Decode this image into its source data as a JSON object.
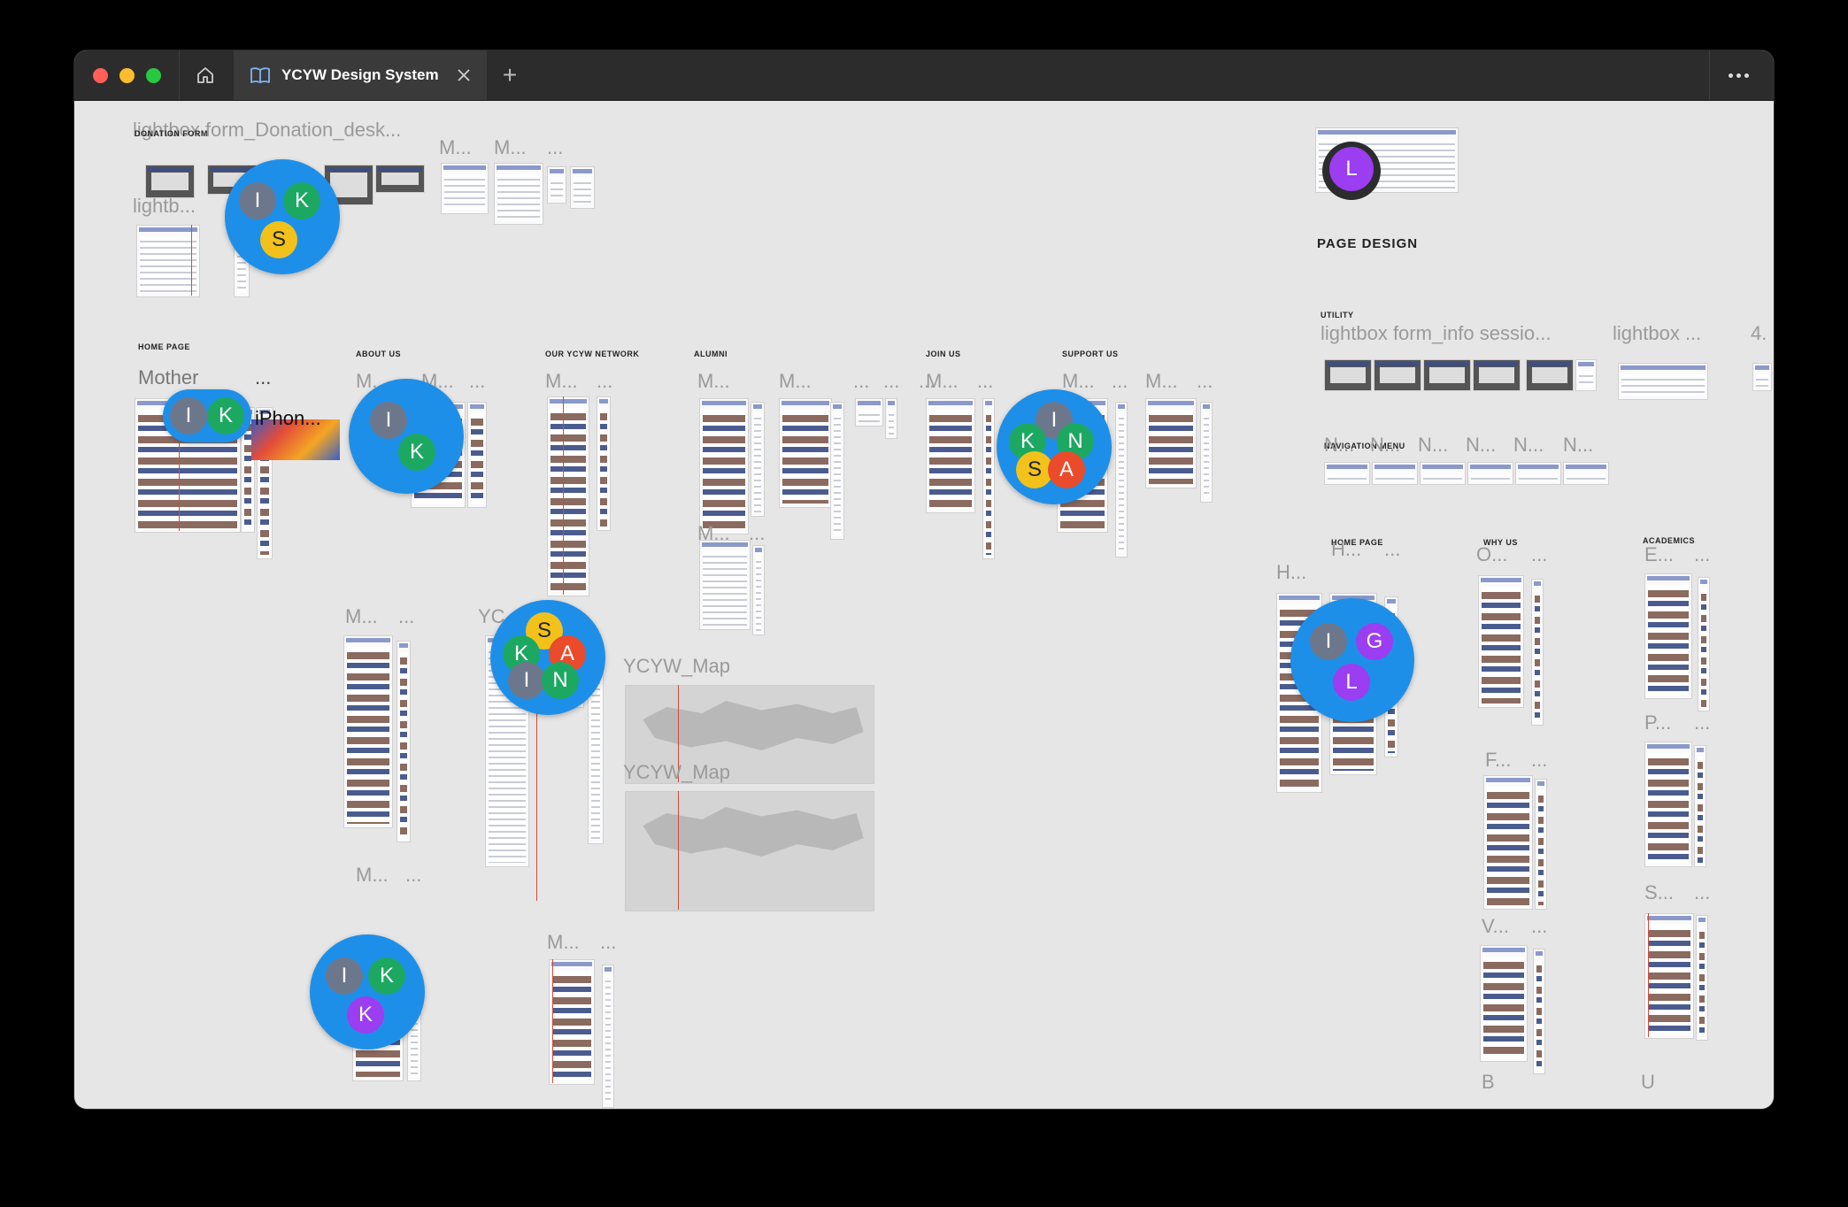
{
  "window": {
    "tab_title": "YCYW Design System",
    "new_tab_label": "+",
    "traffic_lights": {
      "close": "#ff5f57",
      "minimize": "#febc2e",
      "zoom": "#28c840"
    }
  },
  "canvas": {
    "frame_labels": {
      "lightbox_donation": "lightbox form_Donation_desk...",
      "lightb": "lightb...",
      "m1": "M...",
      "m2": "M...",
      "dots": "...",
      "mother": "Mother",
      "iphon": "iPhon...",
      "yc": "YC",
      "ycyw_map_1": "YCYW_Map",
      "ycyw_map_2": "YCYW_Map",
      "lightbox_info": "lightbox form_info sessio...",
      "lightbox_short": "lightbox ...",
      "four": "4.",
      "n": "N...",
      "h": "H...",
      "o": "O...",
      "e": "E...",
      "p": "P...",
      "f": "F...",
      "s": "S...",
      "v": "V...",
      "b": "B",
      "u": "U"
    },
    "section_titles": {
      "donation_form": "DONATION FORM",
      "home_page": "HOME PAGE",
      "about_us": "ABOUT US",
      "our_ycyw_network": "OUR YCYW NETWORK",
      "alumni": "ALUMNI",
      "join_us": "JOIN US",
      "support_us": "SUPPORT US",
      "page_design": "PAGE DESIGN",
      "utility": "UTILITY",
      "navigation_menu": "NAVIGATION MENU",
      "home_page_2": "HOME PAGE",
      "why_us": "WHY US",
      "academics": "ACADEMICS"
    },
    "avatars": {
      "i": "I",
      "k": "K",
      "s": "S",
      "n": "N",
      "a": "A",
      "g": "G",
      "l": "L"
    }
  }
}
